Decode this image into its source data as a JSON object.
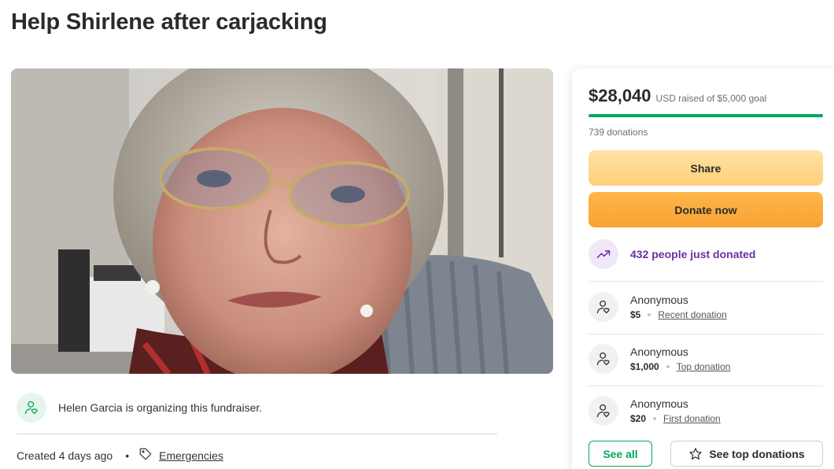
{
  "page": {
    "title": "Help Shirlene after carjacking"
  },
  "organizer": {
    "text": "Helen Garcia is organizing this fundraiser.",
    "icon": "user-heart-icon"
  },
  "meta": {
    "created": "Created 4 days ago",
    "separator": "•",
    "category": "Emergencies",
    "category_icon": "tag-icon"
  },
  "fundraiser": {
    "raised": "$28,040",
    "goal_text": "USD raised of $5,000 goal",
    "progress_fraction": 1.0,
    "donations_count": "739 donations"
  },
  "actions": {
    "share_label": "Share",
    "donate_label": "Donate now",
    "see_all_label": "See all",
    "see_top_label": "See top donations"
  },
  "trending": {
    "text": "432 people just donated",
    "icon": "trending-up-icon"
  },
  "donations": [
    {
      "name": "Anonymous",
      "amount": "$5",
      "kind": "Recent donation"
    },
    {
      "name": "Anonymous",
      "amount": "$1,000",
      "kind": "Top donation"
    },
    {
      "name": "Anonymous",
      "amount": "$20",
      "kind": "First donation"
    }
  ],
  "colors": {
    "brand_green": "#02a95c",
    "share_button": "#ffcf78",
    "donate_button": "#f7a233",
    "trending_purple": "#6b2fa0"
  }
}
